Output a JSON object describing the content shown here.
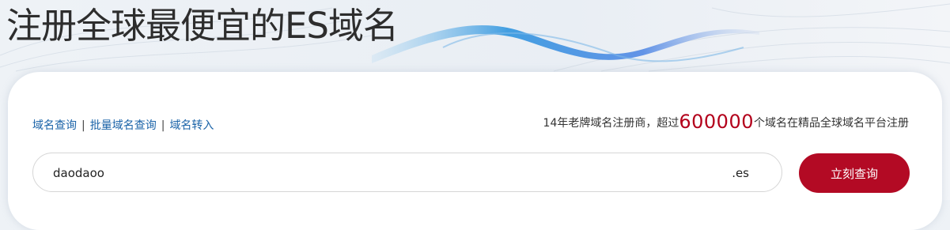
{
  "header": {
    "title": "注册全球最便宜的ES域名"
  },
  "nav_links": {
    "domain_query": "域名查询",
    "separator": "|",
    "bulk_query": "批量域名查询",
    "transfer": "域名转入"
  },
  "slogan": {
    "prefix": "14年老牌域名注册商，超过",
    "number": "600000",
    "suffix": "个域名在精品全球域名平台注册"
  },
  "search": {
    "value": "daodaoo",
    "tld": ".es",
    "button_label": "立刻查询"
  },
  "colors": {
    "accent_red": "#b30a24",
    "link_blue": "#1a63a8",
    "number_red": "#b3001b"
  }
}
